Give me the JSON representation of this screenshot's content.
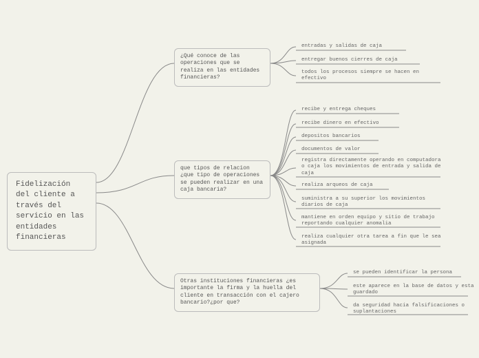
{
  "root": {
    "label": "Fidelización del cliente a través del servicio en las entidades financieras"
  },
  "branches": [
    {
      "label": "¿Qué conoce de las operaciones que se realiza en las entidades financieras?",
      "leaves": [
        "entradas y salidas de caja",
        "entregar buenos cierres de caja",
        "todos los procesos siempre se hacen en efectivo"
      ]
    },
    {
      "label": "que tipos de relacion ¿que tipo de operaciones se pueden realizar en una caja bancaria?",
      "leaves": [
        "recibe y entrega cheques",
        "recibe dinero en efectivo",
        "depositos bancarios",
        "documentos de valor",
        "registra directamente operando en computadora o caja los movimientos de entrada y salida de caja",
        "realiza arqueos de caja",
        "suministra a su superior los movimientos diarios de caja",
        "mantiene en orden equipo y sitio de trabajo reportando cualquier anomalia",
        "realiza cualquier otra tarea a fin que le sea asignada"
      ]
    },
    {
      "label": "Otras instituciones financieras ¿es importante la firma y la huella del cliente en transacción con el cajero bancario?¿por que?",
      "leaves": [
        "se pueden identificar la persona",
        "este aparece en la base de datos y esta guardado",
        "da seguridad hacia falsificaciones o suplantaciones"
      ]
    }
  ]
}
